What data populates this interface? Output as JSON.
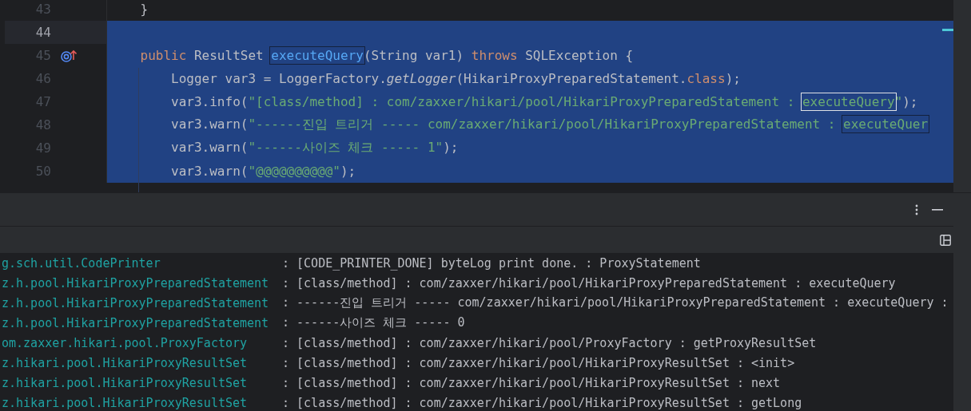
{
  "editor": {
    "lines": [
      {
        "number": "43",
        "current": false,
        "selected": false,
        "implemented": false,
        "segments": [
          {
            "text": "    }",
            "kind": "plain"
          }
        ]
      },
      {
        "number": "44",
        "current": true,
        "selected": true,
        "implemented": false
      },
      {
        "number": "45",
        "current": false,
        "selected": true,
        "implemented": true,
        "segments": [
          {
            "text": "    public",
            "kind": "keyword"
          },
          {
            "text": " ResultSet ",
            "kind": "plain"
          },
          {
            "text": "executeQuery",
            "kind": "declaration_match"
          },
          {
            "text": "(String var1) ",
            "kind": "plain"
          },
          {
            "text": "throws",
            "kind": "keyword"
          },
          {
            "text": " SQLException {",
            "kind": "plain"
          }
        ]
      },
      {
        "number": "46",
        "current": false,
        "selected": true,
        "implemented": false,
        "segments": [
          {
            "text": "        Logger var3 = LoggerFactory.",
            "kind": "plain"
          },
          {
            "text": "getLogger",
            "kind": "static"
          },
          {
            "text": "(HikariProxyPreparedStatement.",
            "kind": "plain"
          },
          {
            "text": "class",
            "kind": "keyword"
          },
          {
            "text": ");",
            "kind": "plain"
          }
        ]
      },
      {
        "number": "47",
        "current": false,
        "selected": true,
        "implemented": false,
        "segments": [
          {
            "text": "        var3.info(",
            "kind": "plain"
          },
          {
            "text": "\"[class/method] : com/zaxxer/hikari/pool/HikariProxyPreparedStatement : ",
            "kind": "string"
          },
          {
            "text": "executeQuery",
            "kind": "string_current_match"
          },
          {
            "text": "\"",
            "kind": "string"
          },
          {
            "text": ");",
            "kind": "plain"
          }
        ]
      },
      {
        "number": "48",
        "current": false,
        "selected": true,
        "implemented": false,
        "segments": [
          {
            "text": "        var3.warn(",
            "kind": "plain"
          },
          {
            "text": "\"------진입 트리거 ----- com/zaxxer/hikari/pool/HikariProxyPreparedStatement : ",
            "kind": "string"
          },
          {
            "text": "executeQuer",
            "kind": "string_match"
          }
        ]
      },
      {
        "number": "49",
        "current": false,
        "selected": true,
        "implemented": false,
        "segments": [
          {
            "text": "        var3.warn(",
            "kind": "plain"
          },
          {
            "text": "\"------사이즈 체크 ----- 1\"",
            "kind": "string"
          },
          {
            "text": ");",
            "kind": "plain"
          }
        ]
      },
      {
        "number": "50",
        "current": false,
        "selected": true,
        "implemented": false,
        "segments": [
          {
            "text": "        var3.warn(",
            "kind": "plain"
          },
          {
            "text": "\"@@@@@@@@@@\"",
            "kind": "string"
          },
          {
            "text": ");",
            "kind": "plain"
          }
        ]
      }
    ]
  },
  "console": {
    "rows": [
      {
        "logger": "g.sch.util.CodePrinter",
        "message": ": [CODE_PRINTER_DONE] byteLog print done. : ProxyStatement"
      },
      {
        "logger": "z.h.pool.HikariProxyPreparedStatement",
        "message": ": [class/method] : com/zaxxer/hikari/pool/HikariProxyPreparedStatement : executeQuery"
      },
      {
        "logger": "z.h.pool.HikariProxyPreparedStatement",
        "message": ": ------진입 트리거 ----- com/zaxxer/hikari/pool/HikariProxyPreparedStatement : executeQuery :"
      },
      {
        "logger": "z.h.pool.HikariProxyPreparedStatement",
        "message": ": ------사이즈 체크 ----- 0"
      },
      {
        "logger": "om.zaxxer.hikari.pool.ProxyFactory",
        "message": ": [class/method] : com/zaxxer/hikari/pool/ProxyFactory : getProxyResultSet"
      },
      {
        "logger": "z.hikari.pool.HikariProxyResultSet",
        "message": ": [class/method] : com/zaxxer/hikari/pool/HikariProxyResultSet : <init>"
      },
      {
        "logger": "z.hikari.pool.HikariProxyResultSet",
        "message": ": [class/method] : com/zaxxer/hikari/pool/HikariProxyResultSet : next"
      },
      {
        "logger": "z.hikari.pool.HikariProxyResultSet",
        "message": ": [class/method] : com/zaxxer/hikari/pool/HikariProxyResultSet : getLong"
      }
    ]
  }
}
